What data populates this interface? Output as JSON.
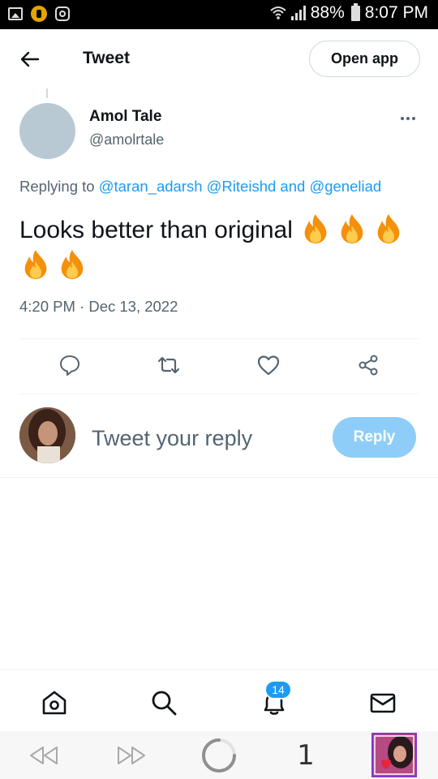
{
  "status_bar": {
    "battery": "88%",
    "time": "8:07 PM"
  },
  "header": {
    "title": "Tweet",
    "open_app_label": "Open app"
  },
  "tweet": {
    "author_name": "Amol Tale",
    "author_handle": "@amolrtale",
    "replying_prefix": "Replying to",
    "mention_1": "@taran_adarsh",
    "mention_2": "@Riteishd",
    "mention_joiner": "and",
    "mention_3": "@geneliad",
    "text": "Looks better than original",
    "fire_emoji_count": 5,
    "timestamp": "4:20 PM · Dec 13, 2022"
  },
  "composer": {
    "placeholder": "Tweet your reply",
    "reply_label": "Reply"
  },
  "bottom_nav": {
    "notifications_badge": "14"
  },
  "browser_bar": {
    "tab_count": "1"
  },
  "icons": {
    "action_icons": [
      "reply-icon",
      "retweet-icon",
      "like-icon",
      "share-icon"
    ],
    "nav_icons": [
      "home-icon",
      "search-icon",
      "notifications-icon",
      "messages-icon"
    ]
  },
  "colors": {
    "accent": "#1d9bf0",
    "reply_button_disabled": "#8ecdf7",
    "secondary_text": "#536471"
  }
}
